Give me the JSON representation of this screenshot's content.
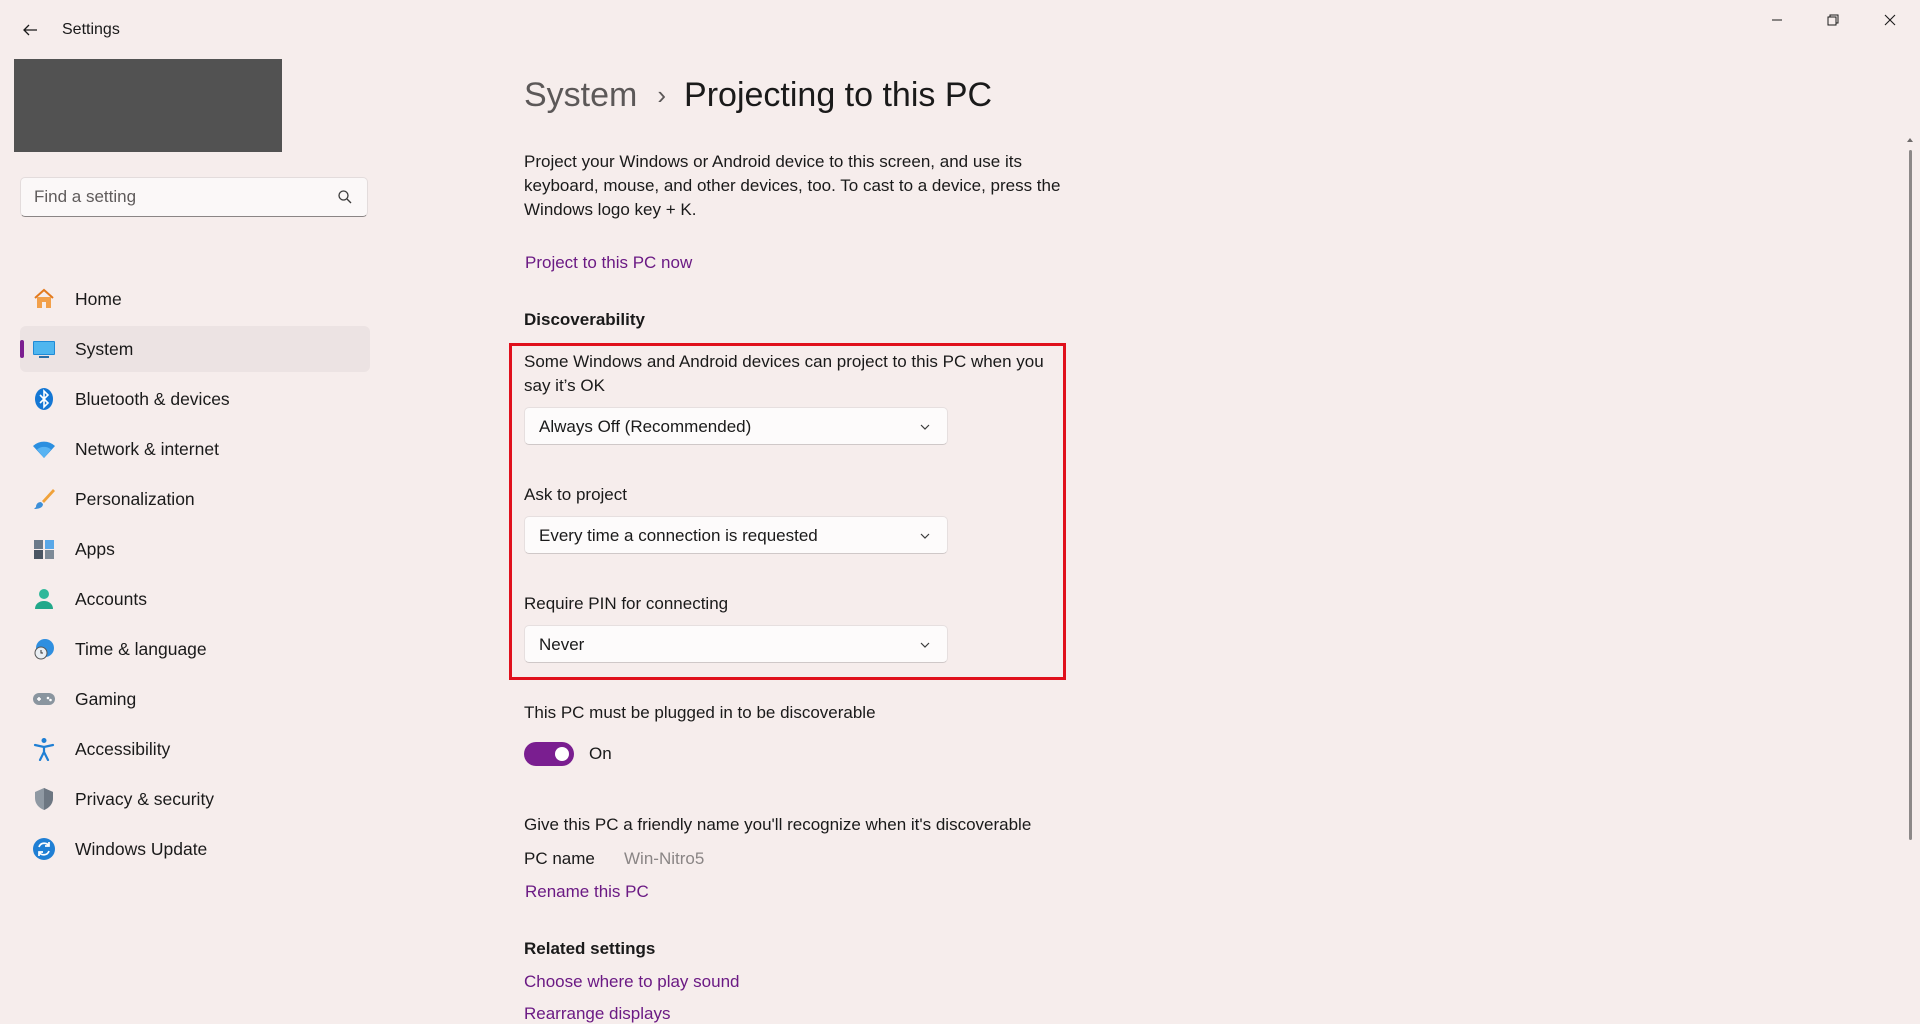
{
  "window": {
    "title": "Settings",
    "back_icon": "back-arrow-icon",
    "minimize_icon": "minimize-icon",
    "maximize_icon": "restore-icon",
    "close_icon": "close-icon"
  },
  "search": {
    "placeholder": "Find a setting",
    "icon": "search-icon"
  },
  "sidebar": {
    "items": [
      {
        "label": "Home",
        "icon": "home-icon"
      },
      {
        "label": "System",
        "icon": "system-icon",
        "selected": true
      },
      {
        "label": "Bluetooth & devices",
        "icon": "bluetooth-icon"
      },
      {
        "label": "Network & internet",
        "icon": "wifi-icon"
      },
      {
        "label": "Personalization",
        "icon": "brush-icon"
      },
      {
        "label": "Apps",
        "icon": "apps-icon"
      },
      {
        "label": "Accounts",
        "icon": "accounts-icon"
      },
      {
        "label": "Time & language",
        "icon": "globe-clock-icon"
      },
      {
        "label": "Gaming",
        "icon": "gamepad-icon"
      },
      {
        "label": "Accessibility",
        "icon": "accessibility-icon"
      },
      {
        "label": "Privacy & security",
        "icon": "shield-icon"
      },
      {
        "label": "Windows Update",
        "icon": "update-icon"
      }
    ]
  },
  "main": {
    "breadcrumb": {
      "parent": "System",
      "separator": "›",
      "current": "Projecting to this PC"
    },
    "description": "Project your Windows or Android device to this screen, and use its keyboard, mouse, and other devices, too. To cast to a device, press the Windows logo key + K.",
    "project_link": "Project to this PC now",
    "discoverability": {
      "title": "Discoverability",
      "availability_label": "Some Windows and Android devices can project to this PC when you say it’s OK",
      "availability_value": "Always Off (Recommended)",
      "ask_label": "Ask to project",
      "ask_value": "Every time a connection is requested",
      "pin_label": "Require PIN for connecting",
      "pin_value": "Never"
    },
    "plugged": {
      "label": "This PC must be plugged in to be discoverable",
      "toggle_state": "On",
      "toggle_on": true
    },
    "friendly_name": {
      "label": "Give this PC a friendly name you'll recognize when it's discoverable",
      "pc_name_label": "PC name",
      "pc_name_value": "Win-Nitro5",
      "rename_link": "Rename this PC"
    },
    "related": {
      "title": "Related settings",
      "links": [
        "Choose where to play sound",
        "Rearrange displays"
      ]
    }
  },
  "colors": {
    "accent": "#7a1e90",
    "link": "#6b1a84",
    "highlight_border": "#e0101c",
    "background": "#f6edec"
  }
}
